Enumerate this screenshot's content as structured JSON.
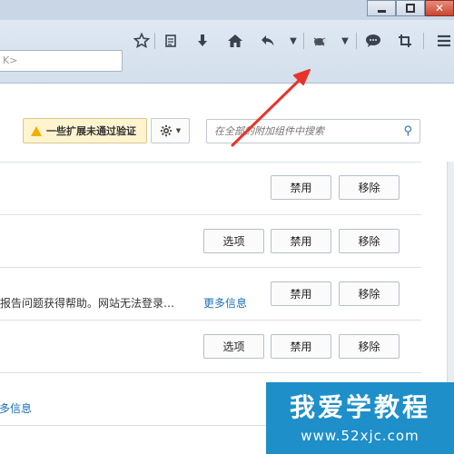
{
  "window": {
    "controls": [
      "minimize",
      "maximize",
      "close"
    ],
    "close_glyph": "✕"
  },
  "toolbar": {
    "url_text": "K>",
    "icons": [
      "bookmark-star-icon",
      "reading-list-icon",
      "download-icon",
      "home-icon",
      "back-icon",
      "history-dropdown-icon",
      "addon-bug-icon",
      "addon-dropdown-icon",
      "chat-icon",
      "crop-icon",
      "menu-icon"
    ]
  },
  "addons": {
    "warning_label": "一些扩展未通过验证",
    "search_placeholder": "在全部的附加组件中搜索",
    "rows": [
      {
        "buttons": {
          "disable": "禁用",
          "remove": "移除"
        }
      },
      {
        "buttons": {
          "options": "选项",
          "disable": "禁用",
          "remove": "移除"
        }
      },
      {
        "description": "报告问题获得帮助。网站无法登录…",
        "more_info": "更多信息",
        "buttons": {
          "disable": "禁用",
          "remove": "移除"
        }
      },
      {
        "buttons": {
          "options": "选项",
          "disable": "禁用",
          "remove": "移除"
        }
      }
    ],
    "partial_more_info": "多信息"
  },
  "watermark": {
    "title": "我爱学教程",
    "url": "www.52xjc.com",
    "color": "#1e8fc9"
  },
  "annotation": {
    "arrow_color": "#e8332a"
  }
}
